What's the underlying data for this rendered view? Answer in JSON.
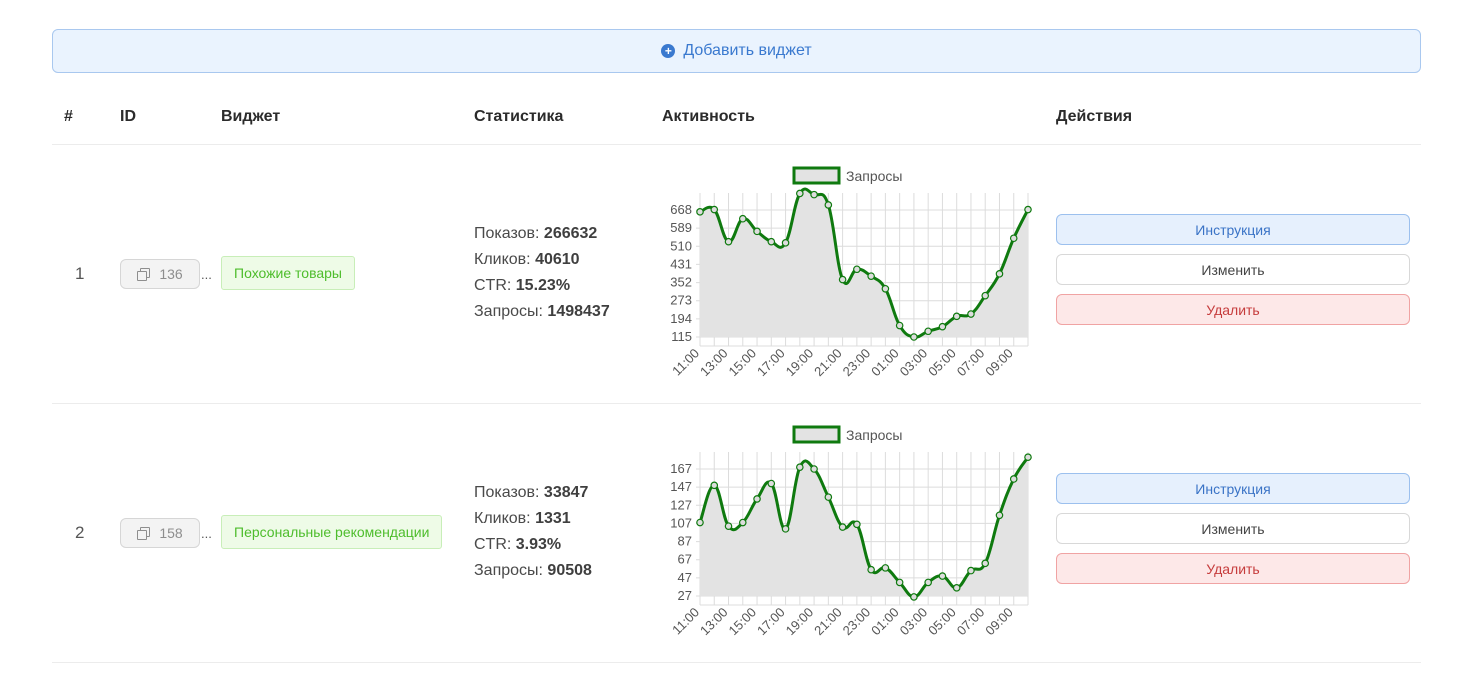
{
  "add_widget_label": "Добавить виджет",
  "columns": {
    "num": "#",
    "id": "ID",
    "widget": "Виджет",
    "stats": "Статистика",
    "activity": "Активность",
    "actions": "Действия"
  },
  "stat_labels": {
    "shows": "Показов:",
    "clicks": "Кликов:",
    "ctr": "CTR:",
    "requests": "Запросы:"
  },
  "action_labels": {
    "instruction": "Инструкция",
    "edit": "Изменить",
    "delete": "Удалить"
  },
  "ellipsis": "...",
  "colors": {
    "series_line": "#0f7a0f",
    "series_fill": "#e3e3e3",
    "grid": "#dcdcdc",
    "primary": "#3a79cf",
    "danger": "#c63c3c",
    "tag_green": "#4ebd2c"
  },
  "widgets": [
    {
      "num": "1",
      "id": "136",
      "name": "Похожие товары",
      "shows": "266632",
      "clicks": "40610",
      "ctr": "15.23%",
      "requests": "1498437",
      "chart_data": {
        "type": "line",
        "legend": [
          "Запросы"
        ],
        "legend_position": "top",
        "grid": true,
        "x": [
          "11:00",
          "12:00",
          "13:00",
          "14:00",
          "15:00",
          "16:00",
          "17:00",
          "18:00",
          "19:00",
          "20:00",
          "21:00",
          "22:00",
          "23:00",
          "00:00",
          "01:00",
          "02:00",
          "03:00",
          "04:00",
          "05:00",
          "06:00",
          "07:00",
          "08:00",
          "09:00",
          "10:00"
        ],
        "xtick_labels": [
          "11:00",
          "13:00",
          "15:00",
          "17:00",
          "19:00",
          "21:00",
          "23:00",
          "01:00",
          "03:00",
          "05:00",
          "07:00",
          "09:00"
        ],
        "ytick_labels": [
          "115",
          "194",
          "273",
          "352",
          "431",
          "510",
          "589",
          "668"
        ],
        "ylim": [
          115,
          668
        ],
        "series": [
          {
            "name": "Запросы",
            "values": [
              660,
              670,
              530,
              630,
              575,
              530,
              525,
              740,
              735,
              690,
              365,
              410,
              380,
              325,
              165,
              115,
              140,
              160,
              205,
              215,
              295,
              390,
              545,
              670
            ]
          }
        ]
      }
    },
    {
      "num": "2",
      "id": "158",
      "name": "Персональные рекомендации",
      "shows": "33847",
      "clicks": "1331",
      "ctr": "3.93%",
      "requests": "90508",
      "chart_data": {
        "type": "line",
        "legend": [
          "Запросы"
        ],
        "legend_position": "top",
        "grid": true,
        "x": [
          "11:00",
          "12:00",
          "13:00",
          "14:00",
          "15:00",
          "16:00",
          "17:00",
          "18:00",
          "19:00",
          "20:00",
          "21:00",
          "22:00",
          "23:00",
          "00:00",
          "01:00",
          "02:00",
          "03:00",
          "04:00",
          "05:00",
          "06:00",
          "07:00",
          "08:00",
          "09:00",
          "10:00"
        ],
        "xtick_labels": [
          "11:00",
          "13:00",
          "15:00",
          "17:00",
          "19:00",
          "21:00",
          "23:00",
          "01:00",
          "03:00",
          "05:00",
          "07:00",
          "09:00"
        ],
        "ytick_labels": [
          "27",
          "47",
          "67",
          "87",
          "107",
          "127",
          "147",
          "167"
        ],
        "ylim": [
          27,
          167
        ],
        "series": [
          {
            "name": "Запросы",
            "values": [
              108,
              149,
              104,
              108,
              134,
              151,
              101,
              169,
              167,
              136,
              103,
              106,
              56,
              58,
              42,
              26,
              42,
              49,
              36,
              55,
              63,
              116,
              156,
              180
            ]
          }
        ]
      }
    }
  ]
}
